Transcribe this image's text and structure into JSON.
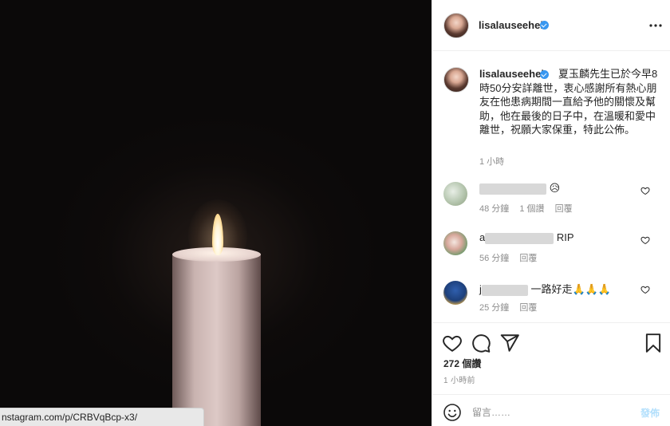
{
  "post": {
    "author": "lisalauseehei",
    "verified": true,
    "caption": "夏玉麟先生已於今早8時50分安詳離世，衷心感謝所有熱心朋友在他患病期間一直給予他的關懷及幫助，他在最後的日子中，在溫暖和愛中離世，祝願大家保重，特此公佈。",
    "caption_time": "1 小時",
    "likes": "272 個讚",
    "post_time": "1 小時前"
  },
  "comments": [
    {
      "user_visible": "",
      "text": "😥",
      "time": "48 分鐘",
      "likes": "1 個讚",
      "reply": "回覆"
    },
    {
      "user_visible": "a",
      "text": "RIP",
      "time": "56 分鐘",
      "likes": "",
      "reply": "回覆"
    },
    {
      "user_visible": "j",
      "text": "一路好走🙏🙏🙏",
      "time": "25 分鐘",
      "likes": "",
      "reply": "回覆"
    }
  ],
  "comment_box": {
    "placeholder": "留言……",
    "post_label": "發佈"
  },
  "status_url": "nstagram.com/p/CRBVqBcp-x3/",
  "colors": {
    "verified": "#3897f0",
    "post_disabled": "#b2dffc",
    "meta": "#8e8e8e"
  },
  "icons": [
    "more-icon",
    "heart-icon",
    "comment-icon",
    "share-icon",
    "bookmark-icon",
    "emoji-icon",
    "verified-badge-icon"
  ]
}
